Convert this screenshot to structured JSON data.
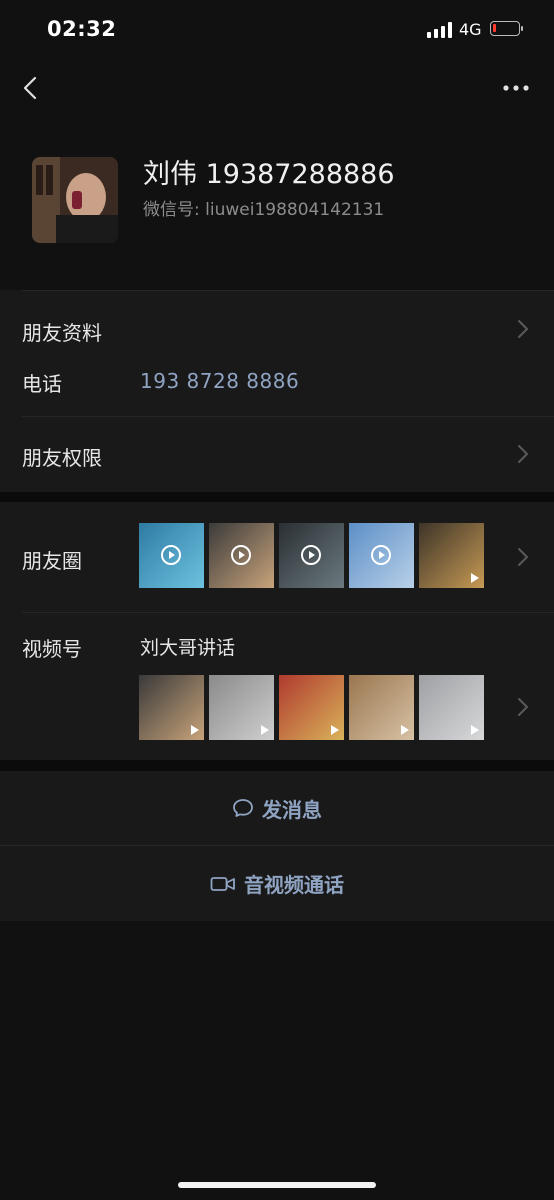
{
  "status_bar": {
    "time": "02:32",
    "network": "4G",
    "battery_level": 0.12
  },
  "profile": {
    "name": "刘伟 19387288886",
    "wechat_id": "微信号: liuwei198804142131"
  },
  "rows": {
    "friend_info_label": "朋友资料",
    "phone_label": "电话",
    "phone_number": "193 8728 8886",
    "permissions_label": "朋友权限"
  },
  "moments": {
    "label": "朋友圈",
    "thumbnails": [
      {
        "kind": "video",
        "colors": [
          "#2e7aa3",
          "#6ec3e0"
        ]
      },
      {
        "kind": "video",
        "colors": [
          "#3b3b3b",
          "#c8a37a"
        ]
      },
      {
        "kind": "video",
        "colors": [
          "#2a2f33",
          "#6b7a80"
        ]
      },
      {
        "kind": "video",
        "colors": [
          "#5c8fc7",
          "#b9d0e8"
        ]
      },
      {
        "kind": "photo",
        "colors": [
          "#3d3428",
          "#c79a55"
        ]
      }
    ]
  },
  "channels": {
    "label": "视频号",
    "title": "刘大哥讲话",
    "thumbnails": [
      {
        "colors": [
          "#3a3a3a",
          "#c8a37a"
        ]
      },
      {
        "colors": [
          "#8a8a8a",
          "#cfcfcf"
        ]
      },
      {
        "colors": [
          "#b03a2e",
          "#d9b35a"
        ]
      },
      {
        "colors": [
          "#9a7650",
          "#d7c2a4"
        ]
      },
      {
        "colors": [
          "#9ea0a3",
          "#d6d8da"
        ]
      }
    ]
  },
  "actions": {
    "message_label": "发消息",
    "call_label": "音视频通话"
  },
  "colors": {
    "link": "#8fa3c2",
    "background": "#111111",
    "card": "#191919"
  }
}
